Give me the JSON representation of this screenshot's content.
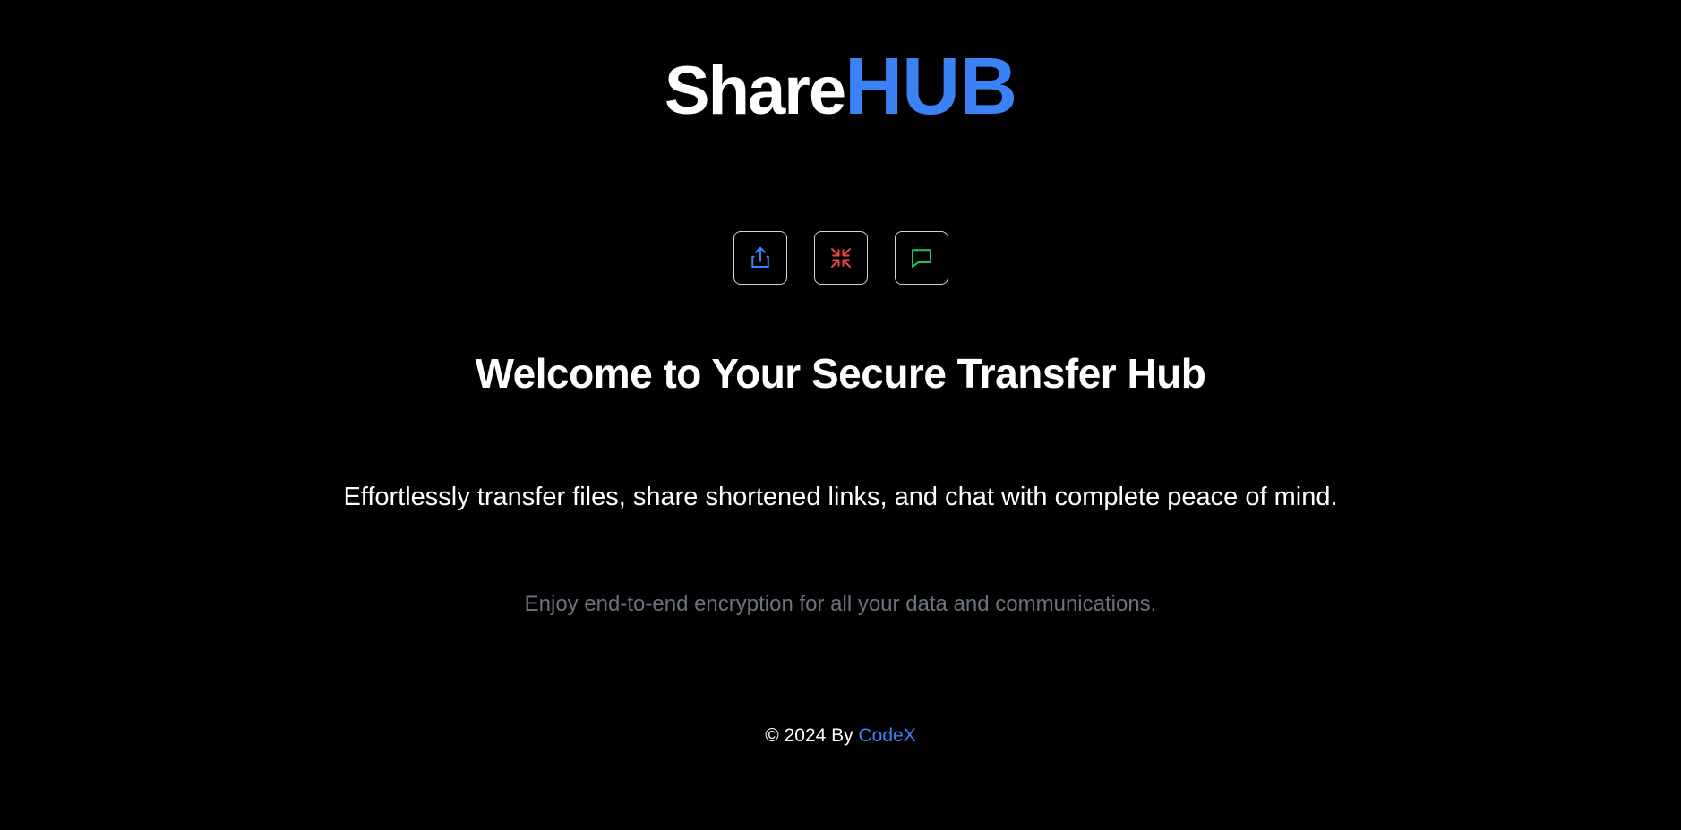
{
  "brand": {
    "part1": "Share",
    "part2": "HUB",
    "accent_color": "#3b82f6"
  },
  "actions": [
    {
      "icon": "share-upload-icon",
      "color": "#3b82f6"
    },
    {
      "icon": "shrink-arrows-icon",
      "color": "#ef4444"
    },
    {
      "icon": "chat-bubble-icon",
      "color": "#22c55e"
    }
  ],
  "hero": {
    "title": "Welcome to Your Secure Transfer Hub",
    "subtitle": "Effortlessly transfer files, share shortened links, and chat with complete peace of mind.",
    "note": "Enjoy end-to-end encryption for all your data and communications."
  },
  "footer": {
    "prefix": "© 2024 By ",
    "author": "CodeX"
  }
}
